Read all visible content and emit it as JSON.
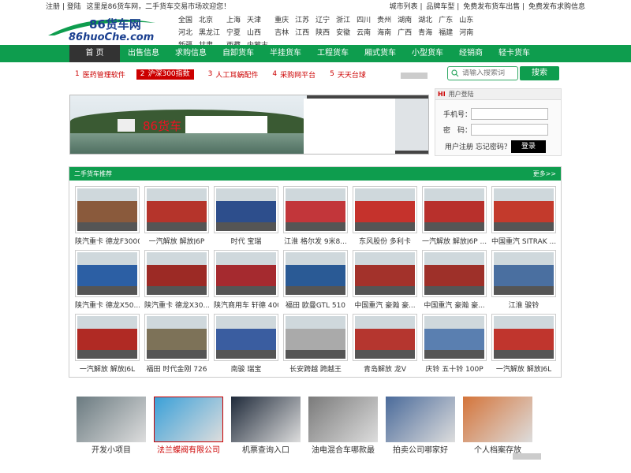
{
  "topbar": {
    "left": [
      "注册",
      "登陆",
      "这里是86货车网，二手货车交易市场欢迎您！"
    ],
    "right": [
      "城市列表",
      "品牌车型",
      "免费发布货车出售",
      "免费发布求购信息"
    ]
  },
  "logo": {
    "title": "86货车网",
    "domain": "86huoChe.com"
  },
  "cities": [
    "全国",
    "北京",
    "上海",
    "天津",
    "重庆",
    "江苏",
    "辽宁",
    "浙江",
    "四川",
    "贵州",
    "湖南",
    "湖北",
    "广东",
    "山东",
    "河北",
    "黑龙江",
    "宁夏",
    "山西",
    "吉林",
    "江西",
    "陕西",
    "安徽",
    "云南",
    "海南",
    "广西",
    "青海",
    "福建",
    "河南",
    "新疆",
    "甘肃",
    "西藏",
    "内蒙古"
  ],
  "nav": [
    "首 页",
    "出售信息",
    "求购信息",
    "自卸货车",
    "半挂货车",
    "工程货车",
    "厢式货车",
    "小型货车",
    "经销商",
    "轻卡货车"
  ],
  "hot": [
    {
      "n": "1",
      "label": "医药管理软件"
    },
    {
      "n": "2",
      "label": "沪深300指数"
    },
    {
      "n": "3",
      "label": "人工耳蜗配件"
    },
    {
      "n": "4",
      "label": "采购网平台"
    },
    {
      "n": "5",
      "label": "天天台球"
    }
  ],
  "search": {
    "placeholder": "请输入搜索词",
    "button": "搜索"
  },
  "banner": {
    "text": "86货车"
  },
  "login": {
    "title": "用户登陆",
    "hi": "HI",
    "phone_label": "手机号：",
    "pwd_label": "密　码：",
    "register": "用户注册",
    "forgot": "忘记密码？",
    "submit": "登录"
  },
  "section": {
    "title": "二手货车推荐",
    "more": "更多>>"
  },
  "trucks": [
    {
      "name": "陕汽重卡 德龙F3000",
      "color": "#8a5a3c"
    },
    {
      "name": "一汽解放 解放J6P",
      "color": "#b5342b"
    },
    {
      "name": "时代 宝瑞",
      "color": "#2d4e8c"
    },
    {
      "name": "江淮 格尔发 9米8...",
      "color": "#c2363a"
    },
    {
      "name": "东风股份 多利卡",
      "color": "#c5322c"
    },
    {
      "name": "一汽解放 解放J6P ...",
      "color": "#b8302c"
    },
    {
      "name": "中国重汽 SITRAK ...",
      "color": "#c33a2c"
    },
    {
      "name": "陕汽重卡 德龙X50...",
      "color": "#2c5fa4"
    },
    {
      "name": "陕汽重卡 德龙X30...",
      "color": "#9c2a25"
    },
    {
      "name": "陕汽商用车 轩德 400",
      "color": "#a52a2f"
    },
    {
      "name": "福田 欧曼GTL 510",
      "color": "#2a5a95"
    },
    {
      "name": "中国重汽 豪瀚 豪...",
      "color": "#a3322b"
    },
    {
      "name": "中国重汽 豪瀚 豪...",
      "color": "#9e3029"
    },
    {
      "name": "江淮 骏铃",
      "color": "#4a6fa0"
    },
    {
      "name": "一汽解放 解放J6L",
      "color": "#b02a24"
    },
    {
      "name": "福田 时代金刚 726",
      "color": "#7d7258"
    },
    {
      "name": "南骏 瑞宝",
      "color": "#3a5da0"
    },
    {
      "name": "长安跨越 跨越王",
      "color": "#aaa"
    },
    {
      "name": "青岛解放 龙V",
      "color": "#b5362f"
    },
    {
      "name": "庆铃 五十铃 100P",
      "color": "#5a7fb0"
    },
    {
      "name": "一汽解放 解放J6L",
      "color": "#c0352d"
    }
  ],
  "ads": [
    {
      "label": "开发小项目",
      "color": "#6a7a80",
      "hl": false
    },
    {
      "label": "法兰蝶阀有限公司",
      "color": "#3aa0d8",
      "hl": true
    },
    {
      "label": "机票查询入口",
      "color": "#1f2a3a",
      "hl": false
    },
    {
      "label": "油电混合车哪款最",
      "color": "#7a7a7a",
      "hl": false
    },
    {
      "label": "拍卖公司哪家好",
      "color": "#4a6a9a",
      "hl": false
    },
    {
      "label": "个人档案存放",
      "color": "#d4743a",
      "hl": false
    }
  ]
}
